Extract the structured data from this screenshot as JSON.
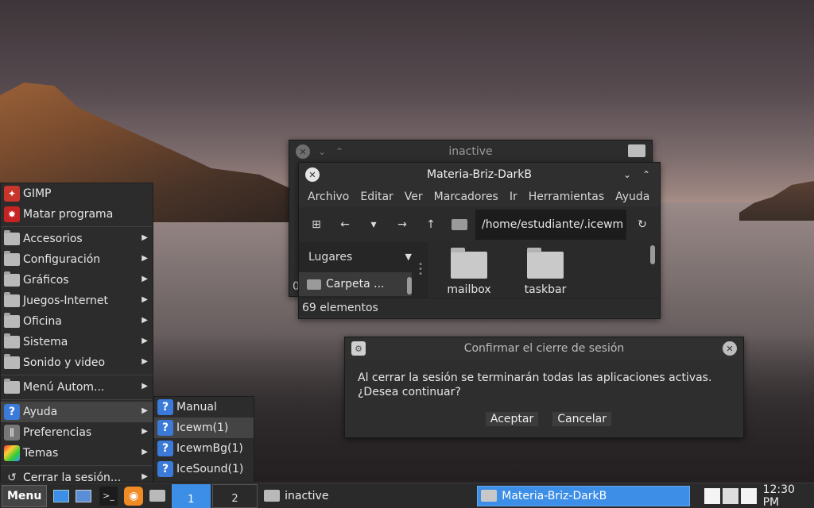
{
  "inactive_window": {
    "title": "inactive",
    "status_partial": "0"
  },
  "file_manager": {
    "title": "Materia-Briz-DarkB",
    "menu": [
      "Archivo",
      "Editar",
      "Ver",
      "Marcadores",
      "Ir",
      "Herramientas",
      "Ayuda"
    ],
    "path": "/home/estudiante/.icewm",
    "sidebar_selector": "Lugares",
    "sidebar_item": "Carpeta ...",
    "files": [
      "mailbox",
      "taskbar"
    ],
    "status": "69 elementos"
  },
  "dialog": {
    "title": "Confirmar el cierre de sesión",
    "line1": "Al cerrar la sesión se terminarán todas las aplicaciones activas.",
    "line2": "¿Desea continuar?",
    "accept": "Aceptar",
    "cancel": "Cancelar"
  },
  "start_menu": {
    "items": [
      {
        "label": "GIMP",
        "icon": "gimp-icon"
      },
      {
        "label": "Matar programa",
        "icon": "kill-icon"
      },
      {
        "label": "Accesorios",
        "icon": "folder-icon"
      },
      {
        "label": "Configuración",
        "icon": "folder-icon"
      },
      {
        "label": "Gráficos",
        "icon": "folder-icon"
      },
      {
        "label": "Juegos-Internet",
        "icon": "folder-icon"
      },
      {
        "label": "Oficina",
        "icon": "folder-icon"
      },
      {
        "label": "Sistema",
        "icon": "folder-icon"
      },
      {
        "label": "Sonido y video",
        "icon": "folder-icon"
      },
      {
        "label": "Menú Autom...",
        "icon": "folder-icon"
      },
      {
        "label": "Ayuda",
        "icon": "help-icon"
      },
      {
        "label": "Preferencias",
        "icon": "preferences-icon"
      },
      {
        "label": "Temas",
        "icon": "themes-icon"
      },
      {
        "label": "Cerrar la sesión...",
        "icon": "logout-icon"
      }
    ]
  },
  "help_submenu": {
    "items": [
      "Manual",
      "Icewm(1)",
      "IcewmBg(1)",
      "IceSound(1)"
    ]
  },
  "taskbar": {
    "menu_label": "Menu",
    "workspaces": [
      "1",
      "2"
    ],
    "tasks": [
      "inactive",
      "Materia-Briz-DarkB"
    ],
    "clock": "12:30 PM"
  },
  "colors": {
    "accent": "#3d8ee6",
    "window_bg": "#2f2f2f",
    "help_blue": "#3b7ad9"
  }
}
